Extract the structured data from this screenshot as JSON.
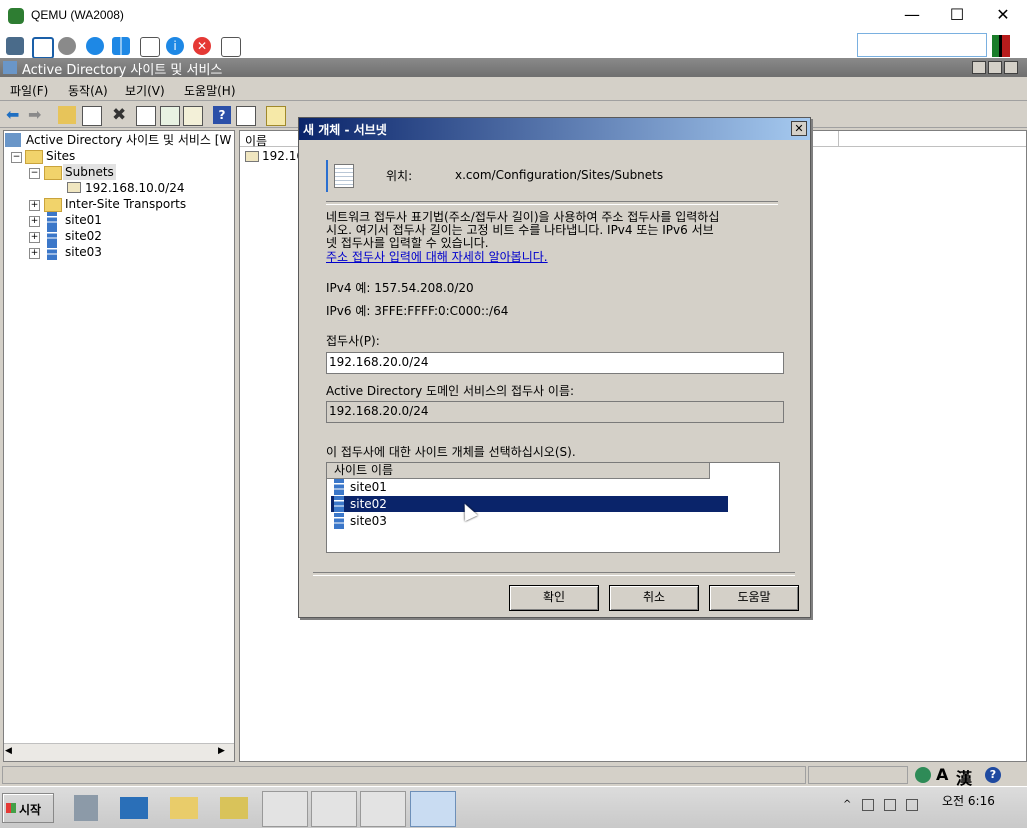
{
  "host": {
    "title": "QEMU (WA2008)",
    "buttons": [
      "—",
      "☐",
      "✕"
    ]
  },
  "mmc": {
    "title": "Active Directory 사이트 및 서비스",
    "menus": [
      "파일(F)",
      "동작(A)",
      "보기(V)",
      "도움말(H)"
    ],
    "tree": {
      "root": "Active Directory 사이트 및 서비스 [W",
      "sites": "Sites",
      "subnets": "Subnets",
      "subnet_item": "192.168.10.0/24",
      "inter_site": "Inter-Site Transports",
      "site01": "site01",
      "site02": "site02",
      "site03": "site03"
    },
    "right_pane": {
      "column_name": "이름",
      "item": "192.168"
    }
  },
  "dialog": {
    "title": "새 개체 - 서브넷",
    "location_label": "위치:",
    "location_value": "x.com/Configuration/Sites/Subnets",
    "description": "네트워크 접두사 표기법(주소/접두사 길이)을 사용하여 주소 접두사를 입력하십시오. 여기서 접두사 길이는 고정 비트 수를 나타냅니다. IPv4 또는 IPv6 서브넷 접두사를 입력할 수 있습니다.",
    "learn_more": "주소 접두사 입력에 대해 자세히 알아봅니다.",
    "ipv4_example": "IPv4 예: 157.54.208.0/20",
    "ipv6_example": "IPv6 예: 3FFE:FFFF:0:C000::/64",
    "prefix_label": "접두사(P):",
    "prefix_value": "192.168.20.0/24",
    "ad_prefix_label": "Active Directory 도메인 서비스의 접두사 이름:",
    "ad_prefix_value": "192.168.20.0/24",
    "site_select_label": "이 접두사에 대한 사이트 개체를 선택하십시오(S).",
    "site_column": "사이트 이름",
    "sites": [
      "site01",
      "site02",
      "site03"
    ],
    "selected_site": "site02",
    "ok": "확인",
    "cancel": "취소",
    "help": "도움말"
  },
  "taskbar": {
    "start": "시작",
    "time": "오전 6:16",
    "ime_mode": "A",
    "ime_hanja": "漢"
  },
  "colors": {
    "selection": "#0a246a",
    "dialog_title_start": "#0a246a",
    "face": "#d4d0c8"
  }
}
